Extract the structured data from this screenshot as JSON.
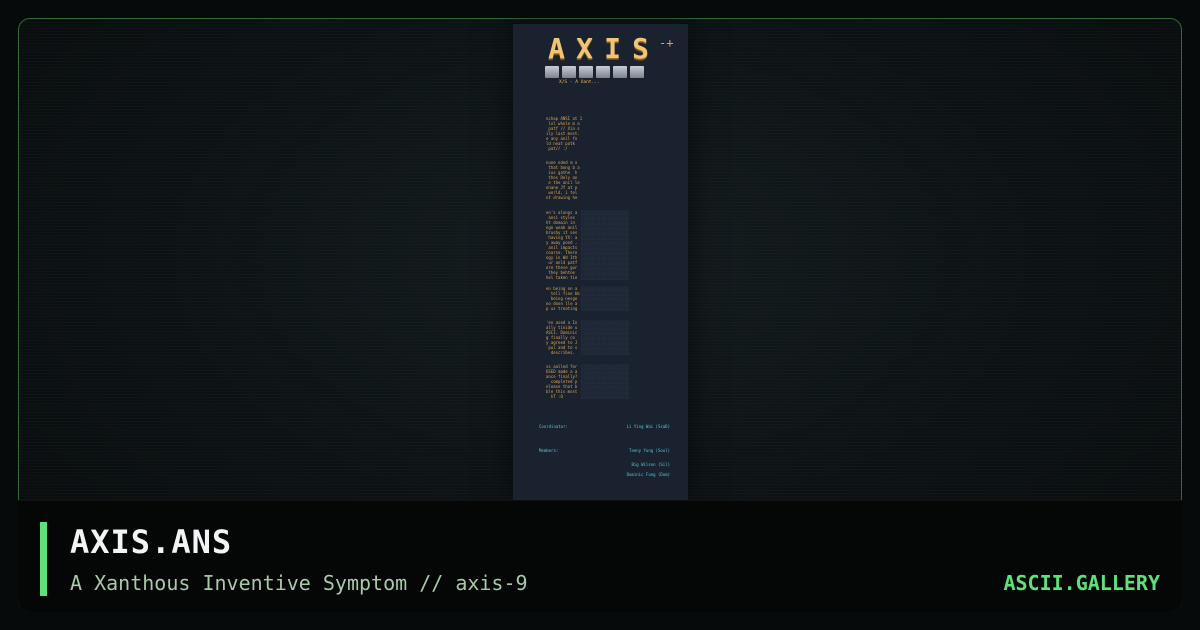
{
  "artwork": {
    "logo_letters": [
      "A",
      "X",
      "I",
      "S"
    ],
    "logo_block_count": 6,
    "logo_spark": "-+",
    "subtitle": "X/S - A Xant...",
    "paragraphs": [
      [
        "nchap ANSI at 1",
        " lol whole m a",
        " patf // Xin s",
        "ily last most.",
        "e any anil fo",
        "ld neat patk",
        " pat// :/"
      ],
      [
        "nune eded m o",
        " that bong b a",
        " ius gathe  h",
        " thos Dely an",
        " e the anil le",
        "nnane Jf at p",
        " world, i tel",
        "nt drawing he"
      ],
      [
        "en's alongs a",
        " ansi styles",
        "ht domain in",
        "nge weak anil",
        "brushy it ses",
        " having YX: a",
        "y away pood ,",
        " anil impacts",
        "coarse. There",
        "ogy in Wd 1th",
        " ur anld patf",
        "ore these gur",
        " they behtne ",
        "hel taken tie"
      ],
      [
        "en being on a",
        "  tell fine bb",
        "  being nesge",
        "oo doon lle a",
        "p us treating"
      ],
      [
        "'en ased a In",
        "ally tinide u",
        "ASCI. Dominic",
        "g finally co",
        "y agreed to J",
        " pul and to s",
        "  describes."
      ],
      [
        "ss aalled for",
        "USED made a a",
        "ance finally?",
        "  completed p",
        "elease that b",
        "ble this most",
        "  hT :O"
      ]
    ],
    "coordinator_label": "Coordinator:",
    "coordinator_value": "Li Ying Wai (SsaD)",
    "members_label": "Members:",
    "members": [
      "Teeny Yung (Soul)",
      "Big Wilson (Sil)",
      "Dominic Fung (Dum)"
    ]
  },
  "footer": {
    "title": "AXIS.ANS",
    "tagline": "A Xanthous Inventive Symptom // axis-9",
    "brand": "ASCII.GALLERY"
  },
  "colors": {
    "accent": "#5ee07a",
    "frame_border": "#2f6b35",
    "art_gold": "#d9a54e",
    "art_cyan": "#56c8d8"
  }
}
